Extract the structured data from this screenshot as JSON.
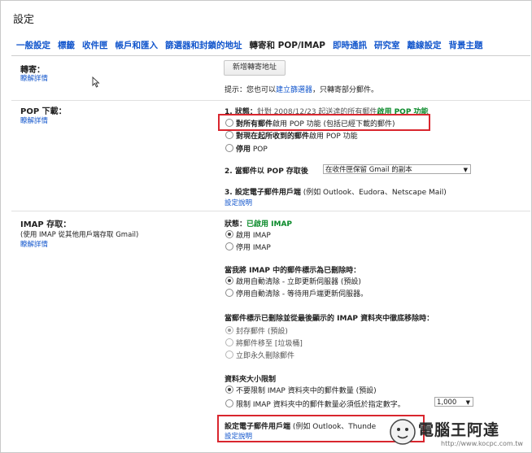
{
  "page_title": "設定",
  "tabs": [
    {
      "label": "一般設定",
      "active": false
    },
    {
      "label": "標籤",
      "active": false
    },
    {
      "label": "收件匣",
      "active": false
    },
    {
      "label": "帳戶和匯入",
      "active": false
    },
    {
      "label": "篩選器和封鎖的地址",
      "active": false
    },
    {
      "label": "轉寄和 POP/IMAP",
      "active": true
    },
    {
      "label": "即時通訊",
      "active": false
    },
    {
      "label": "研究室",
      "active": false
    },
    {
      "label": "離線設定",
      "active": false
    },
    {
      "label": "背景主題",
      "active": false
    }
  ],
  "forwarding": {
    "label": "轉寄：",
    "learn_more": "瞭解詳情",
    "add_button": "新增轉寄地址",
    "hint_prefix": "提示：您也可以",
    "hint_link": "建立篩選器",
    "hint_suffix": "，只轉寄部分郵件。"
  },
  "pop": {
    "label": "POP 下載：",
    "learn_more": "瞭解詳情",
    "status_prefix": "1. 狀態：",
    "status_detail": "針對 2008/12/23 起送達的所有郵件",
    "status_enabled": "啟用 POP 功能",
    "options": [
      {
        "bold": "對所有郵件",
        "rest": "啟用 POP 功能 (包括已經下載的郵件)",
        "checked": false
      },
      {
        "bold": "對現在起所收到的郵件",
        "rest": "啟用 POP 功能",
        "checked": false
      },
      {
        "bold": "停用",
        "rest": " POP",
        "checked": false
      }
    ],
    "access_label": "2. 當郵件以 POP 存取後",
    "access_select": "在收件匣保留 Gmail 的副本",
    "client_label": "3. 設定電子郵件用戶端",
    "client_detail": " (例如 Outlook、Eudora、Netscape Mail)",
    "client_link": "設定說明"
  },
  "imap": {
    "label": "IMAP 存取：",
    "sub": "(使用 IMAP 從其他用戶端存取 Gmail)",
    "learn_more": "瞭解詳情",
    "status_label": "狀態：",
    "status_value": "已啟用 IMAP",
    "enable_options": [
      {
        "label": "啟用 IMAP",
        "checked": true
      },
      {
        "label": "停用 IMAP",
        "checked": false
      }
    ],
    "deleted_heading": "當我將 IMAP 中的郵件標示為已刪除時：",
    "deleted_options": [
      {
        "label": "啟用自動清除 - 立即更新伺服器 (預設)",
        "checked": true
      },
      {
        "label": "停用自動清除 - 等待用戶端更新伺服器。",
        "checked": false
      }
    ],
    "expunge_heading": "當郵件標示已刪除並從最後顯示的 IMAP 資料夾中徹底移除時：",
    "expunge_options": [
      {
        "label": "封存郵件 (預設)",
        "checked": true
      },
      {
        "label": "將郵件移至 [垃圾桶]",
        "checked": false
      },
      {
        "label": "立即永久刪除郵件",
        "checked": false
      }
    ],
    "folder_heading": "資料夾大小限制",
    "folder_options": [
      {
        "label": "不要限制 IMAP 資料夾中的郵件數量 (預設)",
        "checked": true
      },
      {
        "label": "限制 IMAP 資料夾中的郵件數量必須低於指定數字。",
        "checked": false
      }
    ],
    "folder_select": "1,000",
    "client_label": "設定電子郵件用戶端",
    "client_detail": " (例如 Outlook、Thunde",
    "client_link": "設定說明"
  },
  "watermark": {
    "text": "電腦王阿達",
    "url": "http://www.kocpc.com.tw"
  },
  "colors": {
    "link": "#1155cc",
    "enabled_green": "#0a8a2a",
    "highlight_red": "#d9262e"
  }
}
